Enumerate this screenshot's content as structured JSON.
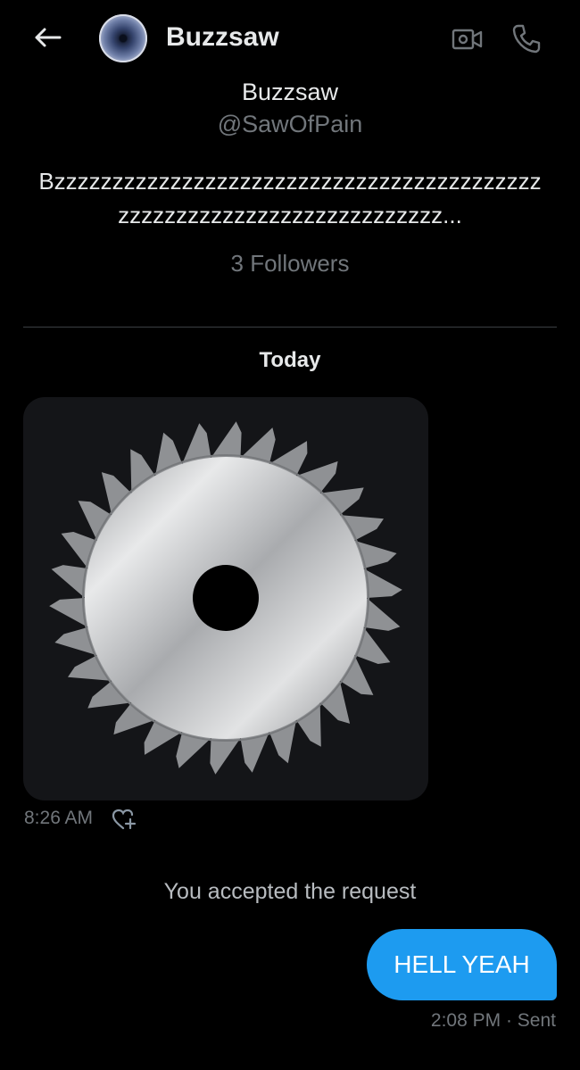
{
  "header": {
    "title": "Buzzsaw",
    "back_icon": "arrow-left-icon",
    "video_icon": "video-call-icon",
    "phone_icon": "phone-call-icon"
  },
  "profile": {
    "name": "Buzzsaw",
    "handle": "@SawOfPain",
    "bio": "Bzzzzzzzzzzzzzzzzzzzzzzzzzzzzzzzzzzzzzzzzzzzzzzzzzzzzzzzzzzzzzzzzzzzzzz...",
    "followers": "3 Followers"
  },
  "conversation": {
    "date_label": "Today",
    "messages": [
      {
        "type": "image",
        "direction": "incoming",
        "image": "circular-saw-blade",
        "time": "8:26 AM",
        "reaction_icon": "heart-plus-icon"
      },
      {
        "type": "system",
        "text": "You accepted the request"
      },
      {
        "type": "text",
        "direction": "outgoing",
        "text": "HELL YEAH",
        "status": "2:08 PM · Sent"
      }
    ]
  },
  "colors": {
    "background": "#000000",
    "text_primary": "#e7e9ea",
    "text_secondary": "#71767b",
    "accent": "#1d9bf0"
  }
}
